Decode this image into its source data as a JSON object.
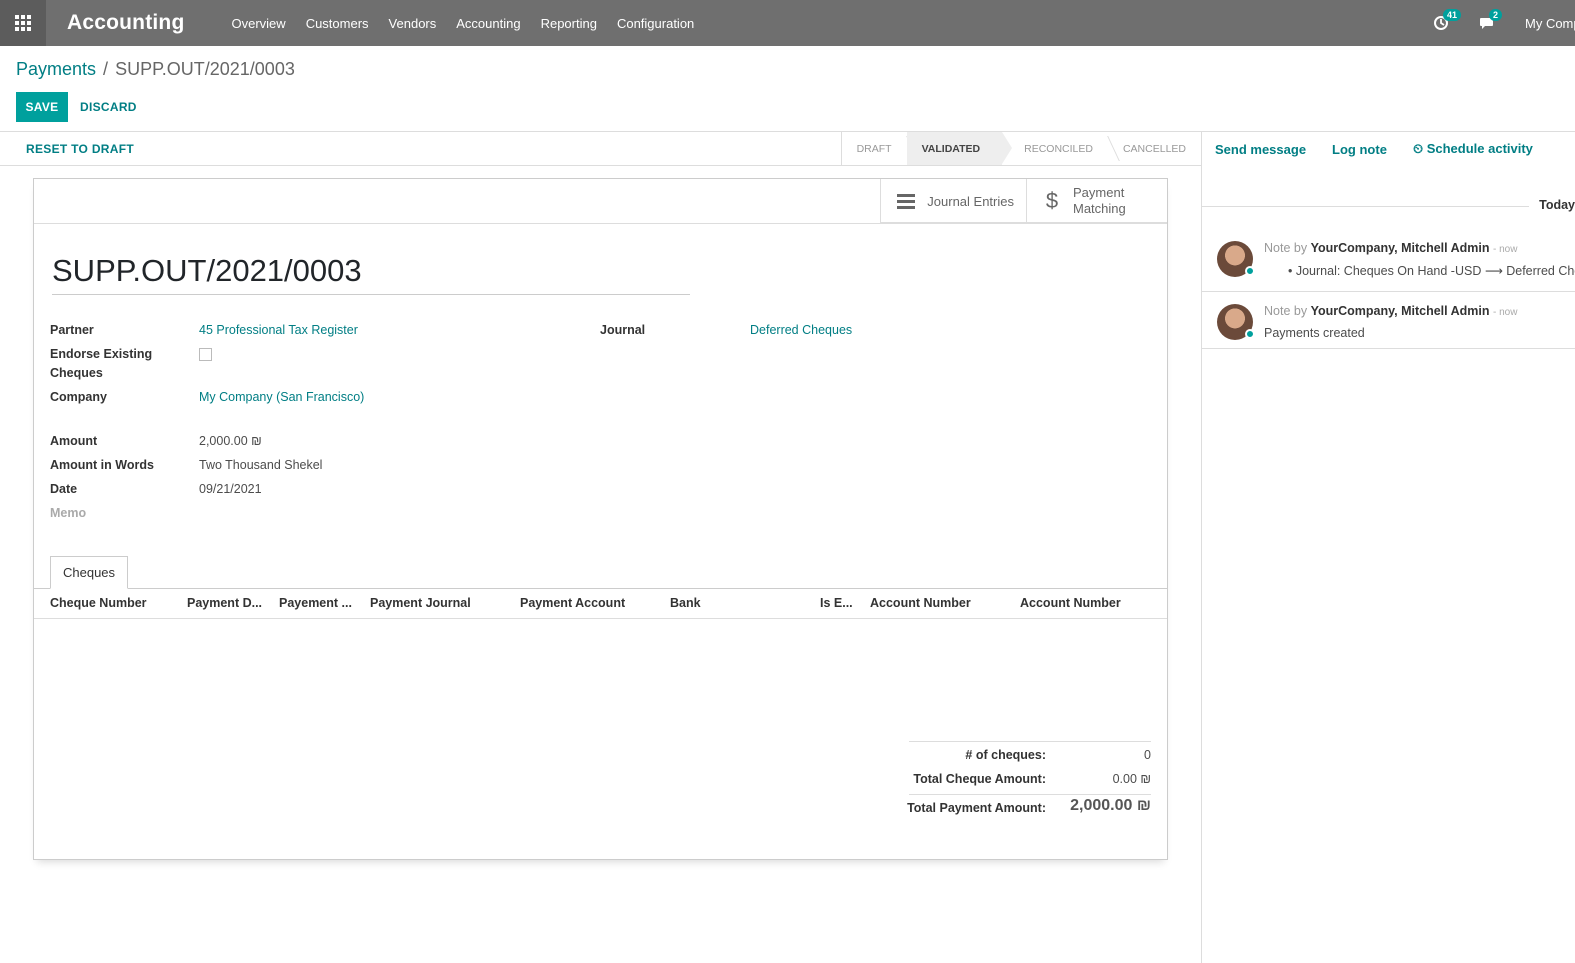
{
  "navbar": {
    "app_name": "Accounting",
    "menu": [
      "Overview",
      "Customers",
      "Vendors",
      "Accounting",
      "Reporting",
      "Configuration"
    ],
    "activity_count": "41",
    "message_count": "2",
    "company": "My Company"
  },
  "breadcrumb": {
    "parent": "Payments",
    "separator": "/",
    "current": "SUPP.OUT/2021/0003"
  },
  "actions": {
    "save": "SAVE",
    "discard": "DISCARD",
    "reset_to_draft": "RESET TO DRAFT"
  },
  "stages": [
    {
      "label": "DRAFT",
      "active": false
    },
    {
      "label": "VALIDATED",
      "active": true
    },
    {
      "label": "RECONCILED",
      "active": false
    },
    {
      "label": "CANCELLED",
      "active": false
    }
  ],
  "smart_buttons": {
    "journal_entries": "Journal Entries",
    "payment_matching_1": "Payment",
    "payment_matching_2": "Matching"
  },
  "form": {
    "title": "SUPP.OUT/2021/0003",
    "partner_label": "Partner",
    "partner": "45 Professional Tax Register",
    "endorse_label_1": "Endorse Existing",
    "endorse_label_2": "Cheques",
    "company_label": "Company",
    "company": "My Company (San Francisco)",
    "journal_label": "Journal",
    "journal": "Deferred Cheques",
    "amount_label": "Amount",
    "amount": "2,000.00 ₪",
    "amount_words_label": "Amount in Words",
    "amount_words": "Two Thousand Shekel",
    "date_label": "Date",
    "date": "09/21/2021",
    "memo_label": "Memo"
  },
  "tab": {
    "label": "Cheques"
  },
  "table": {
    "columns": [
      "Cheque Number",
      "Payment D...",
      "Payement ...",
      "Payment Journal",
      "Payment Account",
      "Bank",
      "Is E...",
      "Account Number",
      "Account Number"
    ]
  },
  "totals": {
    "count_label": "# of cheques:",
    "count": "0",
    "cheque_amount_label": "Total Cheque Amount:",
    "cheque_amount": "0.00 ₪",
    "payment_amount_label": "Total Payment Amount:",
    "payment_amount": "2,000.00 ₪"
  },
  "chatter": {
    "send_message": "Send message",
    "log_note": "Log note",
    "schedule_activity": "Schedule activity",
    "today": "Today",
    "messages": [
      {
        "prefix": "Note by",
        "author": "YourCompany, Mitchell Admin",
        "time": "- now",
        "body": "•  Journal: Cheques On Hand -USD ⟶ Deferred Cheques"
      },
      {
        "prefix": "Note by",
        "author": "YourCompany, Mitchell Admin",
        "time": "- now",
        "body": "Payments created"
      }
    ]
  }
}
